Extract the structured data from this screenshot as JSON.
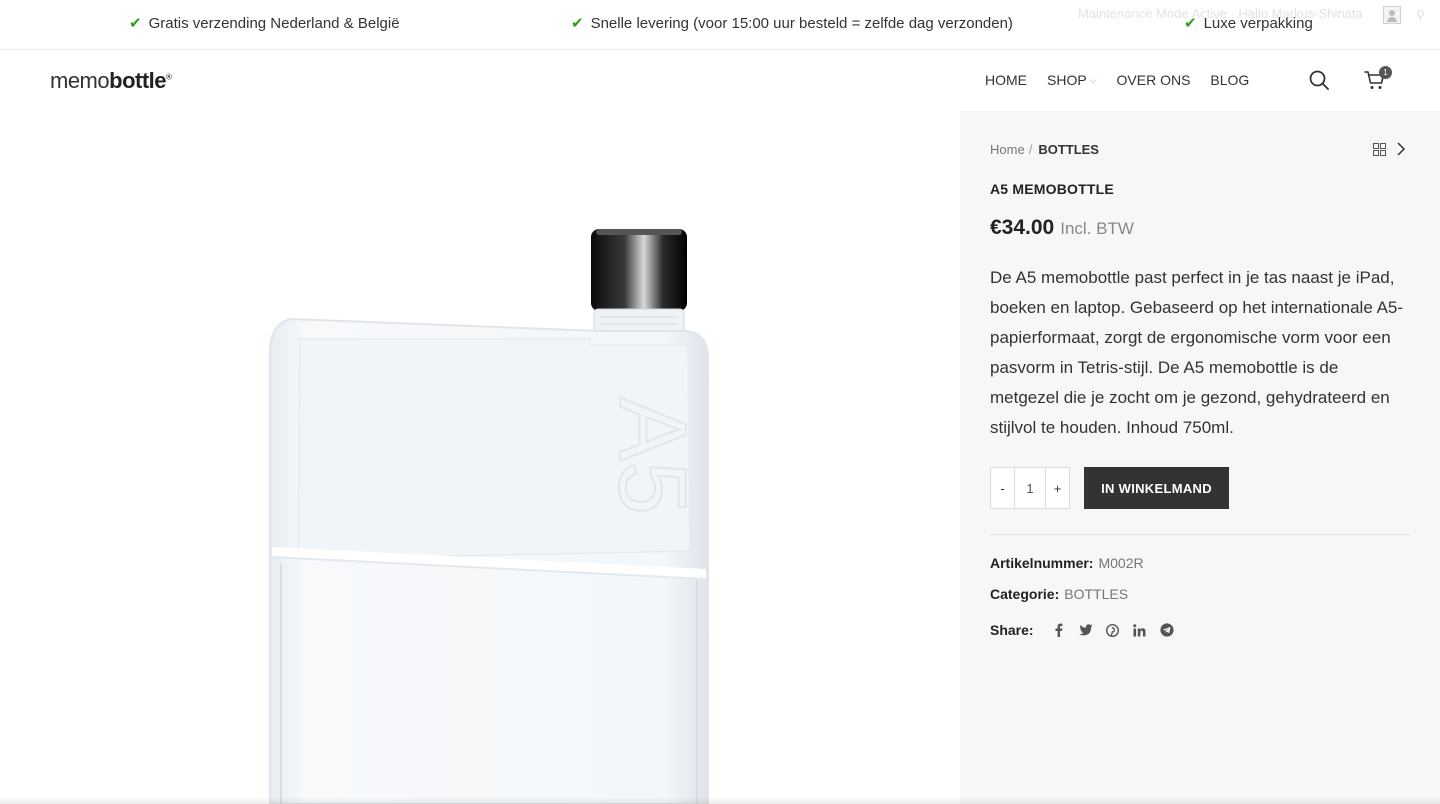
{
  "topbar": {
    "usps": [
      "Gratis verzending Nederland & België",
      "Snelle levering (voor 15:00 uur besteld = zelfde dag verzonden)",
      "Luxe verpakking"
    ],
    "admin_text": "Maintenance Mode Active  ·  Hallo Markus-Shinata"
  },
  "header": {
    "logo_light": "memo",
    "logo_bold": "bottle",
    "nav": [
      "HOME",
      "SHOP",
      "OVER ONS",
      "BLOG"
    ],
    "cart_count": "1"
  },
  "product_image": {
    "bottle_mark": "A5"
  },
  "summary": {
    "breadcrumb_home": "Home",
    "breadcrumb_sep": "/",
    "breadcrumb_current": "BOTTLES",
    "title": "A5 MEMOBOTTLE",
    "price": "€34.00",
    "tax_label": "Incl. BTW",
    "description": "De A5 memobottle past perfect in je tas naast je iPad, boeken en laptop. Gebaseerd op het internationale A5-papierformaat, zorgt de ergonomische vorm voor een pasvorm in Tetris-stijl. De A5 memobottle is de metgezel die je zocht om je gezond, gehydrateerd en stijlvol te houden. Inhoud 750ml.",
    "qty_minus": "-",
    "qty_value": "1",
    "qty_plus": "+",
    "add_to_cart": "IN WINKELMAND",
    "sku_label": "Artikelnummer:",
    "sku_value": "M002R",
    "category_label": "Categorie:",
    "category_value": "BOTTLES",
    "share_label": "Share:",
    "share_icons": [
      "facebook-icon",
      "twitter-icon",
      "pinterest-icon",
      "linkedin-icon",
      "telegram-icon"
    ]
  },
  "colors": {
    "check_green": "#2f9e15",
    "button_dark": "#333333",
    "panel_bg": "#f7f7f7"
  }
}
